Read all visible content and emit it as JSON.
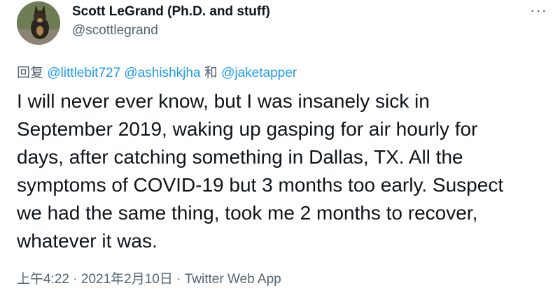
{
  "author": {
    "display_name": "Scott LeGrand (Ph.D. and stuff)",
    "handle": "@scottlegrand"
  },
  "more_icon_glyph": "···",
  "reply_context": {
    "prefix": "回复",
    "mention_1": "@littlebit727",
    "mention_2": "@ashishkjha",
    "joiner": "和",
    "mention_3": "@jaketapper"
  },
  "tweet_lines": [
    "I will never ever know, but I was insanely sick in",
    "September 2019, waking up gasping for air hourly for",
    "days, after catching something in Dallas, TX. All the",
    "symptoms of COVID-19 but 3 months too early. Suspect",
    "we had the same thing, took me 2 months to recover,",
    "whatever it was."
  ],
  "meta": {
    "time": "上午4:22",
    "separator_1": " · ",
    "date": "2021年2月10日",
    "separator_2": " · ",
    "source": "Twitter Web App"
  },
  "colors": {
    "text": "#0f1419",
    "secondary": "#536471",
    "link": "#1d9bf0"
  }
}
